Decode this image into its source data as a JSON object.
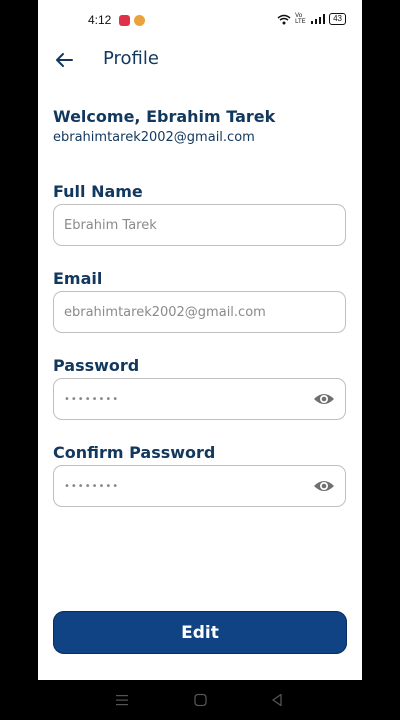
{
  "status_bar": {
    "time": "4:12",
    "network_label": "Vo LTE",
    "battery": "43",
    "notification_colors": [
      "#e0314b",
      "#e8a33c"
    ]
  },
  "app_bar": {
    "title": "Profile",
    "back_icon": "arrow-left-icon"
  },
  "profile": {
    "welcome": "Welcome, Ebrahim Tarek",
    "email": "ebrahimtarek2002@gmail.com"
  },
  "form": {
    "full_name": {
      "label": "Full Name",
      "value": "Ebrahim Tarek"
    },
    "email": {
      "label": "Email",
      "value": "ebrahimtarek2002@gmail.com"
    },
    "password": {
      "label": "Password",
      "value": "••••••••",
      "toggle_icon": "eye-icon"
    },
    "confirm_password": {
      "label": "Confirm Password",
      "value": "••••••••",
      "toggle_icon": "eye-icon"
    }
  },
  "actions": {
    "edit_label": "Edit"
  },
  "theme": {
    "primary": "#0f4384",
    "text": "#12385e",
    "border": "#bfbfbf"
  },
  "system_nav": {
    "icons": [
      "menu-icon",
      "home-icon",
      "back-triangle-icon"
    ]
  }
}
